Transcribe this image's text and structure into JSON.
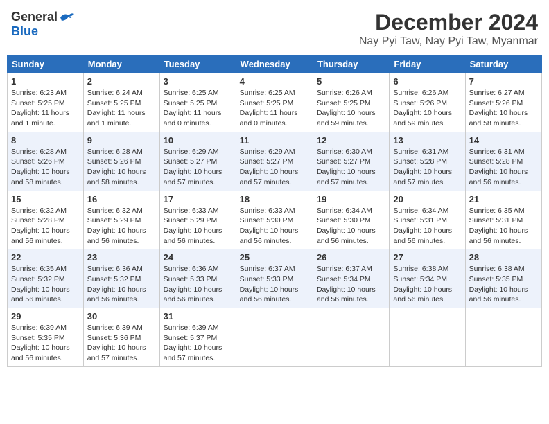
{
  "header": {
    "logo_general": "General",
    "logo_blue": "Blue",
    "month": "December 2024",
    "location": "Nay Pyi Taw, Nay Pyi Taw, Myanmar"
  },
  "weekdays": [
    "Sunday",
    "Monday",
    "Tuesday",
    "Wednesday",
    "Thursday",
    "Friday",
    "Saturday"
  ],
  "weeks": [
    [
      {
        "day": "1",
        "info": "Sunrise: 6:23 AM\nSunset: 5:25 PM\nDaylight: 11 hours\nand 1 minute."
      },
      {
        "day": "2",
        "info": "Sunrise: 6:24 AM\nSunset: 5:25 PM\nDaylight: 11 hours\nand 1 minute."
      },
      {
        "day": "3",
        "info": "Sunrise: 6:25 AM\nSunset: 5:25 PM\nDaylight: 11 hours\nand 0 minutes."
      },
      {
        "day": "4",
        "info": "Sunrise: 6:25 AM\nSunset: 5:25 PM\nDaylight: 11 hours\nand 0 minutes."
      },
      {
        "day": "5",
        "info": "Sunrise: 6:26 AM\nSunset: 5:25 PM\nDaylight: 10 hours\nand 59 minutes."
      },
      {
        "day": "6",
        "info": "Sunrise: 6:26 AM\nSunset: 5:26 PM\nDaylight: 10 hours\nand 59 minutes."
      },
      {
        "day": "7",
        "info": "Sunrise: 6:27 AM\nSunset: 5:26 PM\nDaylight: 10 hours\nand 58 minutes."
      }
    ],
    [
      {
        "day": "8",
        "info": "Sunrise: 6:28 AM\nSunset: 5:26 PM\nDaylight: 10 hours\nand 58 minutes."
      },
      {
        "day": "9",
        "info": "Sunrise: 6:28 AM\nSunset: 5:26 PM\nDaylight: 10 hours\nand 58 minutes."
      },
      {
        "day": "10",
        "info": "Sunrise: 6:29 AM\nSunset: 5:27 PM\nDaylight: 10 hours\nand 57 minutes."
      },
      {
        "day": "11",
        "info": "Sunrise: 6:29 AM\nSunset: 5:27 PM\nDaylight: 10 hours\nand 57 minutes."
      },
      {
        "day": "12",
        "info": "Sunrise: 6:30 AM\nSunset: 5:27 PM\nDaylight: 10 hours\nand 57 minutes."
      },
      {
        "day": "13",
        "info": "Sunrise: 6:31 AM\nSunset: 5:28 PM\nDaylight: 10 hours\nand 57 minutes."
      },
      {
        "day": "14",
        "info": "Sunrise: 6:31 AM\nSunset: 5:28 PM\nDaylight: 10 hours\nand 56 minutes."
      }
    ],
    [
      {
        "day": "15",
        "info": "Sunrise: 6:32 AM\nSunset: 5:28 PM\nDaylight: 10 hours\nand 56 minutes."
      },
      {
        "day": "16",
        "info": "Sunrise: 6:32 AM\nSunset: 5:29 PM\nDaylight: 10 hours\nand 56 minutes."
      },
      {
        "day": "17",
        "info": "Sunrise: 6:33 AM\nSunset: 5:29 PM\nDaylight: 10 hours\nand 56 minutes."
      },
      {
        "day": "18",
        "info": "Sunrise: 6:33 AM\nSunset: 5:30 PM\nDaylight: 10 hours\nand 56 minutes."
      },
      {
        "day": "19",
        "info": "Sunrise: 6:34 AM\nSunset: 5:30 PM\nDaylight: 10 hours\nand 56 minutes."
      },
      {
        "day": "20",
        "info": "Sunrise: 6:34 AM\nSunset: 5:31 PM\nDaylight: 10 hours\nand 56 minutes."
      },
      {
        "day": "21",
        "info": "Sunrise: 6:35 AM\nSunset: 5:31 PM\nDaylight: 10 hours\nand 56 minutes."
      }
    ],
    [
      {
        "day": "22",
        "info": "Sunrise: 6:35 AM\nSunset: 5:32 PM\nDaylight: 10 hours\nand 56 minutes."
      },
      {
        "day": "23",
        "info": "Sunrise: 6:36 AM\nSunset: 5:32 PM\nDaylight: 10 hours\nand 56 minutes."
      },
      {
        "day": "24",
        "info": "Sunrise: 6:36 AM\nSunset: 5:33 PM\nDaylight: 10 hours\nand 56 minutes."
      },
      {
        "day": "25",
        "info": "Sunrise: 6:37 AM\nSunset: 5:33 PM\nDaylight: 10 hours\nand 56 minutes."
      },
      {
        "day": "26",
        "info": "Sunrise: 6:37 AM\nSunset: 5:34 PM\nDaylight: 10 hours\nand 56 minutes."
      },
      {
        "day": "27",
        "info": "Sunrise: 6:38 AM\nSunset: 5:34 PM\nDaylight: 10 hours\nand 56 minutes."
      },
      {
        "day": "28",
        "info": "Sunrise: 6:38 AM\nSunset: 5:35 PM\nDaylight: 10 hours\nand 56 minutes."
      }
    ],
    [
      {
        "day": "29",
        "info": "Sunrise: 6:39 AM\nSunset: 5:35 PM\nDaylight: 10 hours\nand 56 minutes."
      },
      {
        "day": "30",
        "info": "Sunrise: 6:39 AM\nSunset: 5:36 PM\nDaylight: 10 hours\nand 57 minutes."
      },
      {
        "day": "31",
        "info": "Sunrise: 6:39 AM\nSunset: 5:37 PM\nDaylight: 10 hours\nand 57 minutes."
      },
      null,
      null,
      null,
      null
    ]
  ]
}
